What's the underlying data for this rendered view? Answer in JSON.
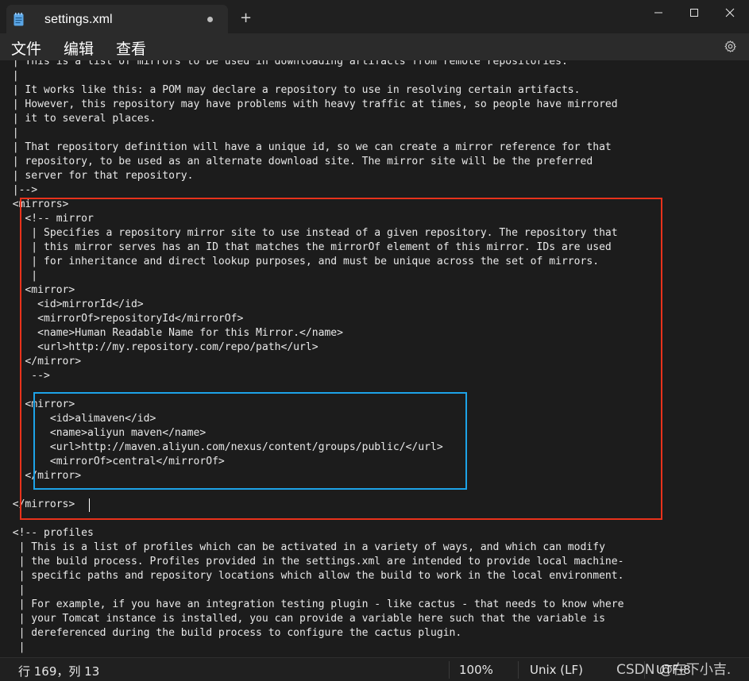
{
  "app": {
    "tab_title": "settings.xml",
    "tab_modified_dot": "•",
    "new_tab_glyph": "+",
    "icons": {
      "file": "notepad-file-icon",
      "minimize": "minimize-icon",
      "maximize": "maximize-icon",
      "close": "close-icon",
      "settings": "gear-icon"
    }
  },
  "menu": {
    "file": "文件",
    "edit": "编辑",
    "view": "查看"
  },
  "editor": {
    "lines": [
      "  | This is a list of mirrors to be used in downloading artifacts from remote repositories.",
      "  |",
      "  | It works like this: a POM may declare a repository to use in resolving certain artifacts.",
      "  | However, this repository may have problems with heavy traffic at times, so people have mirrored",
      "  | it to several places.",
      "  |",
      "  | That repository definition will have a unique id, so we can create a mirror reference for that",
      "  | repository, to be used as an alternate download site. The mirror site will be the preferred",
      "  | server for that repository.",
      "  |-->",
      "  <mirrors>",
      "    <!-- mirror",
      "     | Specifies a repository mirror site to use instead of a given repository. The repository that",
      "     | this mirror serves has an ID that matches the mirrorOf element of this mirror. IDs are used",
      "     | for inheritance and direct lookup purposes, and must be unique across the set of mirrors.",
      "     |",
      "    <mirror>",
      "      <id>mirrorId</id>",
      "      <mirrorOf>repositoryId</mirrorOf>",
      "      <name>Human Readable Name for this Mirror.</name>",
      "      <url>http://my.repository.com/repo/path</url>",
      "    </mirror>",
      "     -->",
      "",
      "    <mirror>",
      "        <id>alimaven</id>",
      "        <name>aliyun maven</name>",
      "        <url>http://maven.aliyun.com/nexus/content/groups/public/</url>",
      "        <mirrorOf>central</mirrorOf>",
      "    </mirror>",
      "",
      "  </mirrors>",
      "",
      "  <!-- profiles",
      "   | This is a list of profiles which can be activated in a variety of ways, and which can modify",
      "   | the build process. Profiles provided in the settings.xml are intended to provide local machine-",
      "   | specific paths and repository locations which allow the build to work in the local environment.",
      "   |",
      "   | For example, if you have an integration testing plugin - like cactus - that needs to know where",
      "   | your Tomcat instance is installed, you can provide a variable here such that the variable is",
      "   | dereferenced during the build process to configure the cactus plugin.",
      "   |"
    ],
    "highlight_colors": {
      "outer_box": "#e8321b",
      "inner_box": "#1da3e8"
    }
  },
  "status": {
    "position": "行 169，列 13",
    "zoom": "100%",
    "line_ending": "Unix (LF)",
    "encoding": "UTF-8"
  },
  "watermark": "CSDN @在下小吉."
}
